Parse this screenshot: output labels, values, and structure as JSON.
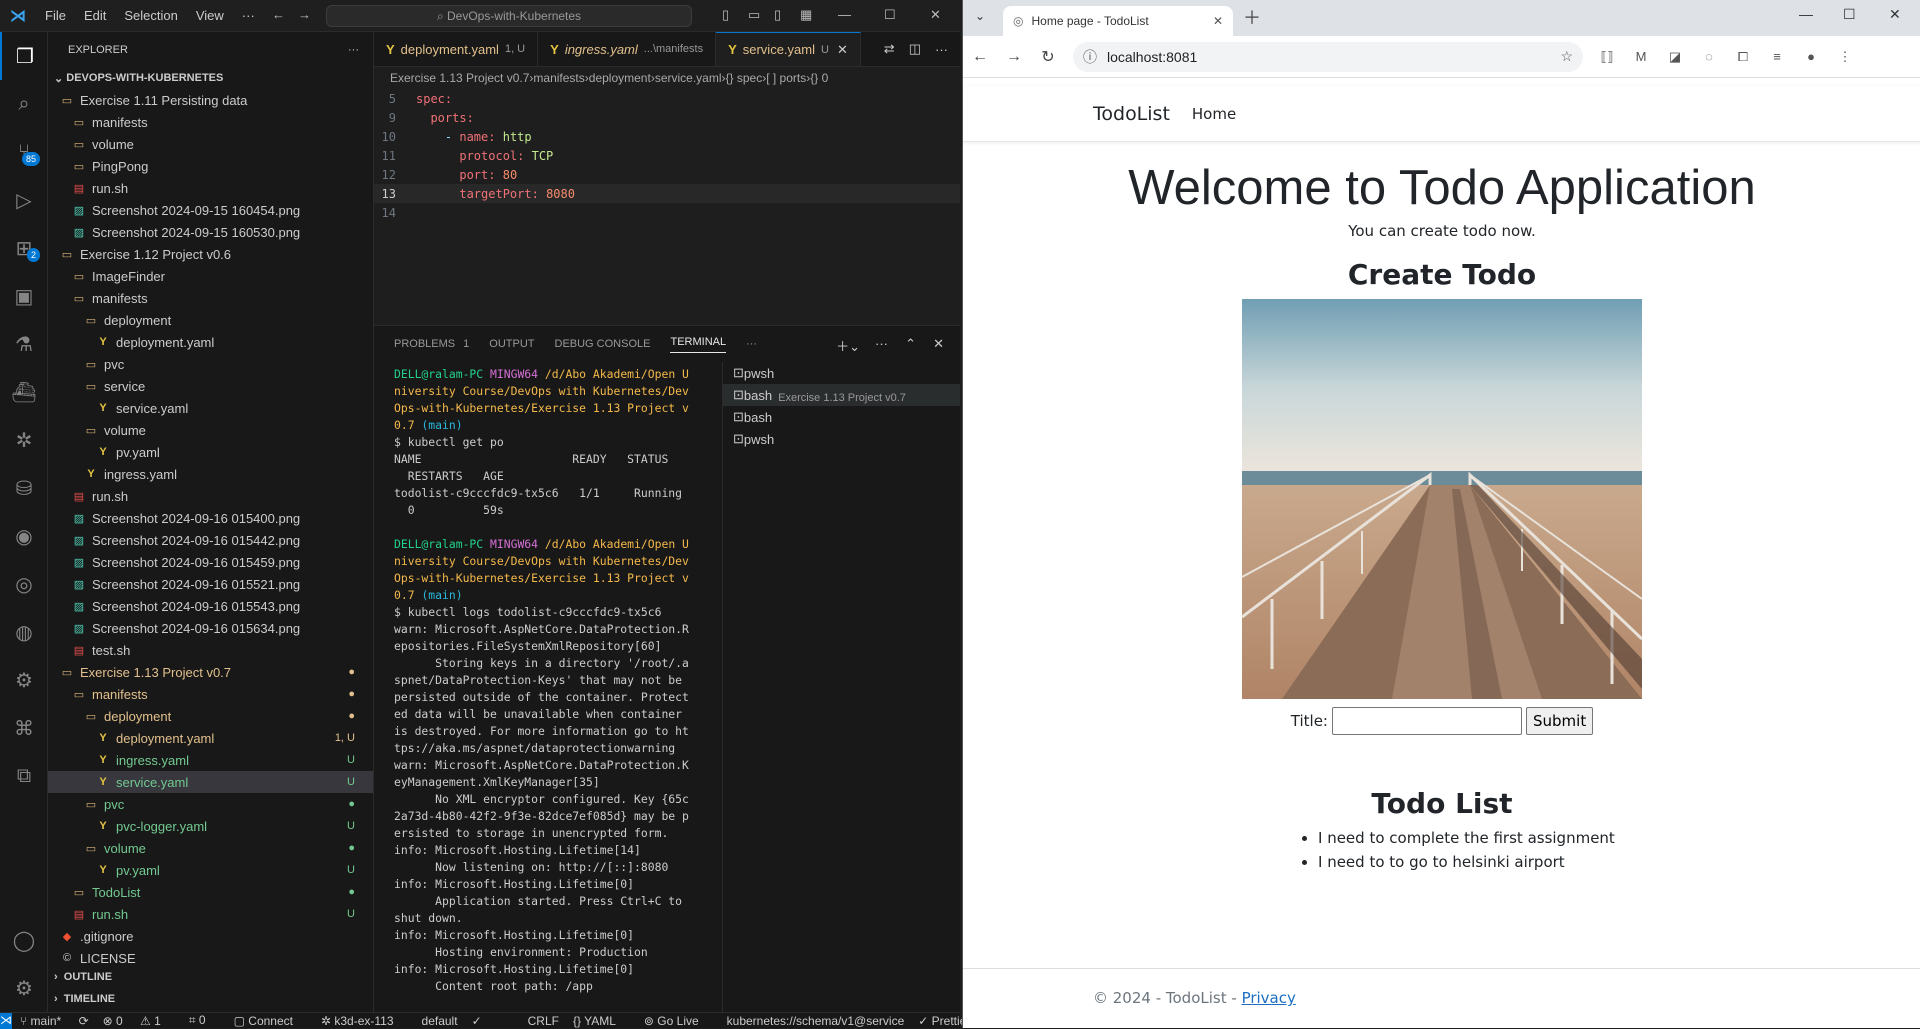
{
  "vscode": {
    "menu": [
      "File",
      "Edit",
      "Selection",
      "View",
      "···"
    ],
    "command_center": "DevOps-with-Kubernetes",
    "activity_badges": {
      "source_control": "85",
      "extensions": "2"
    },
    "explorer": {
      "title": "EXPLORER",
      "root": "DEVOPS-WITH-KUBERNETES",
      "items": [
        {
          "label": "Exercise 1.11 Persisting data",
          "type": "folder",
          "indent": 0,
          "dec": ""
        },
        {
          "label": "manifests",
          "type": "folder",
          "indent": 1,
          "dec": ""
        },
        {
          "label": "volume",
          "type": "folder",
          "indent": 1,
          "dec": ""
        },
        {
          "label": "PingPong",
          "type": "folder",
          "indent": 1,
          "dec": ""
        },
        {
          "label": "run.sh",
          "type": "sh",
          "indent": 1,
          "dec": ""
        },
        {
          "label": "Screenshot 2024-09-15 160454.png",
          "type": "png",
          "indent": 1,
          "dec": ""
        },
        {
          "label": "Screenshot 2024-09-15 160530.png",
          "type": "png",
          "indent": 1,
          "dec": ""
        },
        {
          "label": "Exercise 1.12 Project v0.6",
          "type": "folder",
          "indent": 0,
          "dec": ""
        },
        {
          "label": "ImageFinder",
          "type": "folder",
          "indent": 1,
          "dec": ""
        },
        {
          "label": "manifests",
          "type": "folder",
          "indent": 1,
          "dec": ""
        },
        {
          "label": "deployment",
          "type": "folder",
          "indent": 2,
          "dec": ""
        },
        {
          "label": "deployment.yaml",
          "type": "yaml",
          "indent": 3,
          "dec": ""
        },
        {
          "label": "pvc",
          "type": "folder",
          "indent": 2,
          "dec": ""
        },
        {
          "label": "service",
          "type": "folder",
          "indent": 2,
          "dec": ""
        },
        {
          "label": "service.yaml",
          "type": "yaml",
          "indent": 3,
          "dec": ""
        },
        {
          "label": "volume",
          "type": "folder",
          "indent": 2,
          "dec": ""
        },
        {
          "label": "pv.yaml",
          "type": "yaml",
          "indent": 3,
          "dec": ""
        },
        {
          "label": "ingress.yaml",
          "type": "yaml",
          "indent": 2,
          "dec": ""
        },
        {
          "label": "run.sh",
          "type": "sh",
          "indent": 1,
          "dec": ""
        },
        {
          "label": "Screenshot 2024-09-16 015400.png",
          "type": "png",
          "indent": 1,
          "dec": ""
        },
        {
          "label": "Screenshot 2024-09-16 015442.png",
          "type": "png",
          "indent": 1,
          "dec": ""
        },
        {
          "label": "Screenshot 2024-09-16 015459.png",
          "type": "png",
          "indent": 1,
          "dec": ""
        },
        {
          "label": "Screenshot 2024-09-16 015521.png",
          "type": "png",
          "indent": 1,
          "dec": ""
        },
        {
          "label": "Screenshot 2024-09-16 015543.png",
          "type": "png",
          "indent": 1,
          "dec": ""
        },
        {
          "label": "Screenshot 2024-09-16 015634.png",
          "type": "png",
          "indent": 1,
          "dec": ""
        },
        {
          "label": "test.sh",
          "type": "sh",
          "indent": 1,
          "dec": ""
        },
        {
          "label": "Exercise 1.13 Project v0.7",
          "type": "folder",
          "indent": 0,
          "dec": "●",
          "cls": "o"
        },
        {
          "label": "manifests",
          "type": "folder",
          "indent": 1,
          "dec": "●",
          "cls": "o"
        },
        {
          "label": "deployment",
          "type": "folder",
          "indent": 2,
          "dec": "●",
          "cls": "o"
        },
        {
          "label": "deployment.yaml",
          "type": "yaml",
          "indent": 3,
          "dec": "1, U",
          "cls": "o"
        },
        {
          "label": "ingress.yaml",
          "type": "yaml",
          "indent": 3,
          "dec": "U",
          "cls": "g"
        },
        {
          "label": "service.yaml",
          "type": "yaml",
          "indent": 3,
          "dec": "U",
          "cls": "g",
          "sel": true
        },
        {
          "label": "pvc",
          "type": "folder",
          "indent": 2,
          "dec": "●",
          "cls": "g"
        },
        {
          "label": "pvc-logger.yaml",
          "type": "yaml",
          "indent": 3,
          "dec": "U",
          "cls": "g"
        },
        {
          "label": "volume",
          "type": "folder",
          "indent": 2,
          "dec": "●",
          "cls": "g"
        },
        {
          "label": "pv.yaml",
          "type": "yaml",
          "indent": 3,
          "dec": "U",
          "cls": "g"
        },
        {
          "label": "TodoList",
          "type": "folder",
          "indent": 1,
          "dec": "●",
          "cls": "g"
        },
        {
          "label": "run.sh",
          "type": "sh",
          "indent": 1,
          "dec": "U",
          "cls": "g"
        },
        {
          "label": ".gitignore",
          "type": "git",
          "indent": 0,
          "dec": ""
        },
        {
          "label": "LICENSE",
          "type": "lic",
          "indent": 0,
          "dec": ""
        }
      ],
      "sections": [
        "OUTLINE",
        "TIMELINE"
      ]
    },
    "tabs": [
      {
        "name": "deployment.yaml",
        "suffix": "1, U",
        "active": false,
        "italic": false
      },
      {
        "name": "ingress.yaml",
        "suffix": "...\\manifests",
        "active": false,
        "italic": true
      },
      {
        "name": "service.yaml",
        "suffix": "U",
        "active": true,
        "italic": false
      }
    ],
    "breadcrumbs": [
      "Exercise 1.13 Project v0.7",
      "manifests",
      "deployment",
      "service.yaml",
      "{} spec",
      "[ ] ports",
      "{} 0"
    ],
    "code": [
      {
        "n": "5",
        "t": [
          [
            "k",
            "spec:"
          ]
        ]
      },
      {
        "n": "9",
        "t": [
          [
            "",
            "  "
          ],
          [
            "k",
            "ports:"
          ]
        ]
      },
      {
        "n": "10",
        "t": [
          [
            "",
            "    "
          ],
          [
            "dash",
            "- "
          ],
          [
            "k",
            "name: "
          ],
          [
            "v",
            "http"
          ]
        ]
      },
      {
        "n": "11",
        "t": [
          [
            "",
            "      "
          ],
          [
            "k",
            "protocol: "
          ],
          [
            "v",
            "TCP"
          ]
        ]
      },
      {
        "n": "12",
        "t": [
          [
            "",
            "      "
          ],
          [
            "k",
            "port: "
          ],
          [
            "n",
            "80"
          ]
        ]
      },
      {
        "n": "13",
        "t": [
          [
            "",
            "      "
          ],
          [
            "k",
            "targetPort: "
          ],
          [
            "n",
            "8080"
          ]
        ],
        "cur": true
      },
      {
        "n": "14",
        "t": []
      }
    ],
    "panel_tabs": [
      {
        "label": "PROBLEMS",
        "count": "1"
      },
      {
        "label": "OUTPUT"
      },
      {
        "label": "DEBUG CONSOLE"
      },
      {
        "label": "TERMINAL",
        "active": true
      }
    ],
    "terminal_lines": [
      [
        [
          "tg",
          "DELL@ralam-PC "
        ],
        [
          "tm",
          "MINGW64 "
        ],
        [
          "ty",
          "/d/Abo Akademi/Open U"
        ]
      ],
      [
        [
          "ty",
          "niversity Course/DevOps with Kubernetes/Dev"
        ]
      ],
      [
        [
          "ty",
          "Ops-with-Kubernetes/Exercise 1.13 Project v"
        ]
      ],
      [
        [
          "ty",
          "0.7 "
        ],
        [
          "tc",
          "(main)"
        ]
      ],
      [
        [
          "",
          "$ kubectl get po"
        ]
      ],
      [
        [
          "",
          "NAME                      READY   STATUS"
        ]
      ],
      [
        [
          "",
          "  RESTARTS   AGE"
        ]
      ],
      [
        [
          "",
          "todolist-c9cccfdc9-tx5c6   1/1     Running"
        ]
      ],
      [
        [
          "",
          "  0          59s"
        ]
      ],
      [
        [
          "",
          ""
        ]
      ],
      [
        [
          "tg",
          "DELL@ralam-PC "
        ],
        [
          "tm",
          "MINGW64 "
        ],
        [
          "ty",
          "/d/Abo Akademi/Open U"
        ]
      ],
      [
        [
          "ty",
          "niversity Course/DevOps with Kubernetes/Dev"
        ]
      ],
      [
        [
          "ty",
          "Ops-with-Kubernetes/Exercise 1.13 Project v"
        ]
      ],
      [
        [
          "ty",
          "0.7 "
        ],
        [
          "tc",
          "(main)"
        ]
      ],
      [
        [
          "",
          "$ kubectl logs todolist-c9cccfdc9-tx5c6"
        ]
      ],
      [
        [
          "",
          "warn: Microsoft.AspNetCore.DataProtection.R"
        ]
      ],
      [
        [
          "",
          "epositories.FileSystemXmlRepository[60]"
        ]
      ],
      [
        [
          "",
          "      Storing keys in a directory '/root/.a"
        ]
      ],
      [
        [
          "",
          "spnet/DataProtection-Keys' that may not be"
        ]
      ],
      [
        [
          "",
          "persisted outside of the container. Protect"
        ]
      ],
      [
        [
          "",
          "ed data will be unavailable when container"
        ]
      ],
      [
        [
          "",
          "is destroyed. For more information go to ht"
        ]
      ],
      [
        [
          "",
          "tps://aka.ms/aspnet/dataprotectionwarning"
        ]
      ],
      [
        [
          "",
          "warn: Microsoft.AspNetCore.DataProtection.K"
        ]
      ],
      [
        [
          "",
          "eyManagement.XmlKeyManager[35]"
        ]
      ],
      [
        [
          "",
          "      No XML encryptor configured. Key {65c"
        ]
      ],
      [
        [
          "",
          "2a73d-4b80-42f2-9f3e-82dce7ef085d} may be p"
        ]
      ],
      [
        [
          "",
          "ersisted to storage in unencrypted form."
        ]
      ],
      [
        [
          "",
          "info: Microsoft.Hosting.Lifetime[14]"
        ]
      ],
      [
        [
          "",
          "      Now listening on: http://[::]:8080"
        ]
      ],
      [
        [
          "",
          "info: Microsoft.Hosting.Lifetime[0]"
        ]
      ],
      [
        [
          "",
          "      Application started. Press Ctrl+C to"
        ]
      ],
      [
        [
          "",
          "shut down."
        ]
      ],
      [
        [
          "",
          "info: Microsoft.Hosting.Lifetime[0]"
        ]
      ],
      [
        [
          "",
          "      Hosting environment: Production"
        ]
      ],
      [
        [
          "",
          "info: Microsoft.Hosting.Lifetime[0]"
        ]
      ],
      [
        [
          "",
          "      Content root path: /app"
        ]
      ]
    ],
    "terminal_list": [
      {
        "label": "pwsh",
        "sub": ""
      },
      {
        "label": "bash",
        "sub": "Exercise 1.13 Project v0.7",
        "active": true
      },
      {
        "label": "bash",
        "sub": ""
      },
      {
        "label": "pwsh",
        "sub": ""
      }
    ],
    "status": {
      "branch": "main*",
      "errors": "0",
      "warnings": "1",
      "ports": "0",
      "connect": "Connect",
      "cluster": "k3d-ex-113",
      "namespace": "default",
      "eol": "CRLF",
      "lang": "YAML",
      "golive": "Go Live",
      "schema": "kubernetes://schema/v1@service",
      "prettier": "Prettier"
    }
  },
  "browser": {
    "tab_title": "Home page - TodoList",
    "url": "localhost:8081",
    "page": {
      "brand": "TodoList",
      "nav_home": "Home",
      "welcome": "Welcome to Todo Application",
      "subtitle": "You can create todo now.",
      "create_heading": "Create Todo",
      "title_label": "Title:",
      "submit": "Submit",
      "list_heading": "Todo List",
      "todos": [
        "I need to complete the first assignment",
        "I need to to go to helsinki airport"
      ],
      "footer_text": "© 2024 - TodoList - ",
      "footer_link": "Privacy"
    }
  }
}
